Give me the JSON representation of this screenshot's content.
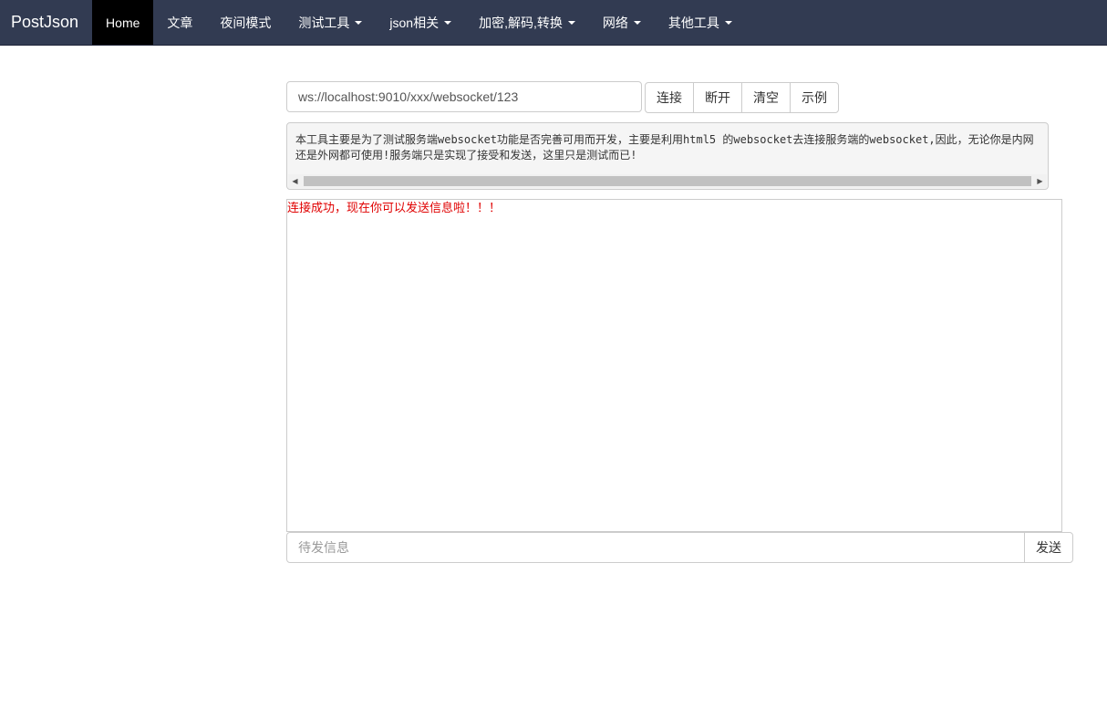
{
  "navbar": {
    "brand": "PostJson",
    "items": [
      {
        "label": "Home",
        "active": true,
        "dropdown": false
      },
      {
        "label": "文章",
        "active": false,
        "dropdown": false
      },
      {
        "label": "夜间模式",
        "active": false,
        "dropdown": false
      },
      {
        "label": "测试工具",
        "active": false,
        "dropdown": true
      },
      {
        "label": "json相关",
        "active": false,
        "dropdown": true
      },
      {
        "label": "加密,解码,转换",
        "active": false,
        "dropdown": true
      },
      {
        "label": "网络",
        "active": false,
        "dropdown": true
      },
      {
        "label": "其他工具",
        "active": false,
        "dropdown": true
      }
    ]
  },
  "connection": {
    "url_value": "ws://localhost:9010/xxx/websocket/123",
    "buttons": {
      "connect": "连接",
      "disconnect": "断开",
      "clear": "清空",
      "example": "示例"
    }
  },
  "info": {
    "text": "本工具主要是为了测试服务端websocket功能是否完善可用而开发，主要是利用html5 的websocket去连接服务端的websocket,因此，无论你是内网还是外网都可使用!服务端只是实现了接受和发送，这里只是测试而已!"
  },
  "log": {
    "messages": [
      "连接成功，现在你可以发送信息啦！！！"
    ]
  },
  "compose": {
    "placeholder": "待发信息",
    "send_label": "发送"
  },
  "colors": {
    "navbar_bg": "#323b52",
    "active_tab_bg": "#000000",
    "log_text": "#e00000"
  }
}
